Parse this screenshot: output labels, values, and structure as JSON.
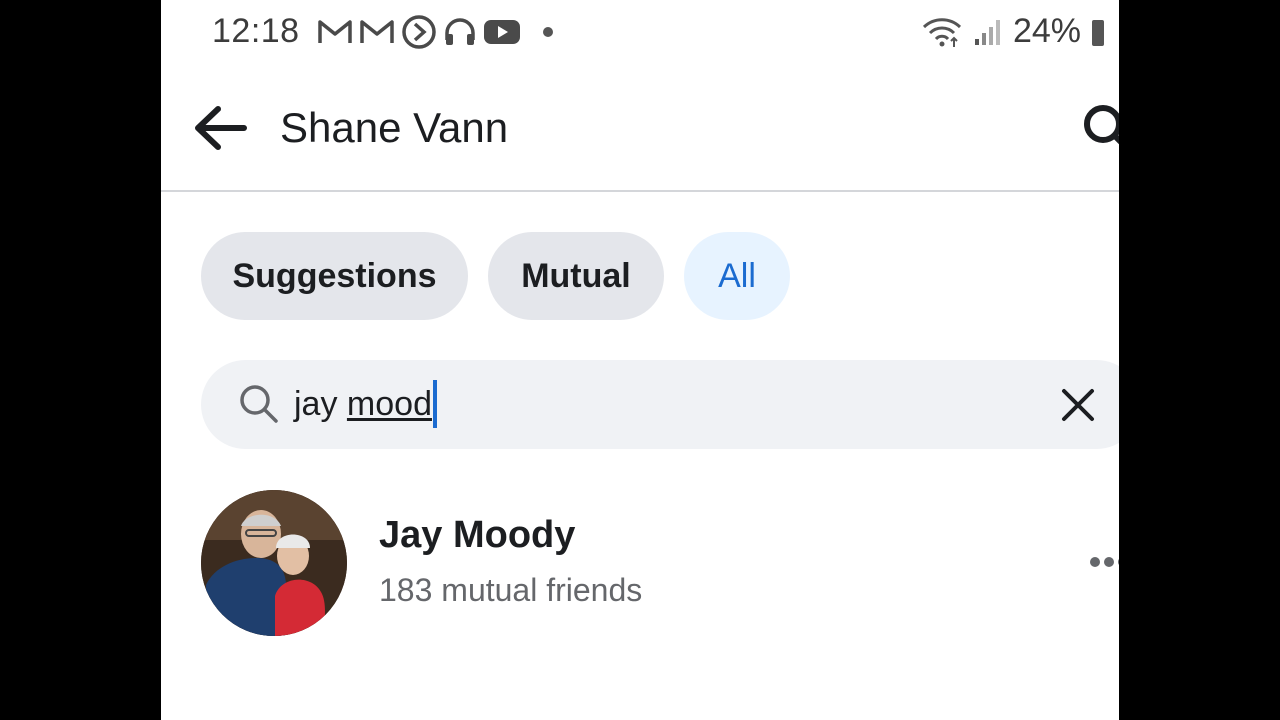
{
  "status_bar": {
    "time": "12:18",
    "battery": "24%",
    "icons_left": [
      "gmail-icon",
      "gmail-icon",
      "media-icon",
      "headphones-icon",
      "youtube-icon",
      "dot-icon"
    ],
    "icons_right": [
      "wifi-icon",
      "signal-icon",
      "battery-icon"
    ]
  },
  "header": {
    "title": "Shane Vann"
  },
  "filters": {
    "suggestions": "Suggestions",
    "mutual": "Mutual",
    "all": "All",
    "active": "All"
  },
  "search": {
    "prefix": "jay ",
    "typed": "mood"
  },
  "results": [
    {
      "name": "Jay Moody",
      "subtitle": "183 mutual friends"
    }
  ],
  "colors": {
    "accent": "#1b6bd0",
    "chip_bg": "#e4e6eb",
    "active_chip_bg": "#e7f3ff",
    "field_bg": "#f0f2f5"
  }
}
